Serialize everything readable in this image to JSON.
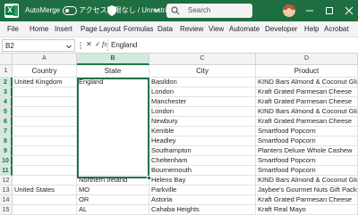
{
  "titlebar": {
    "autosave_label": "AutoMerge",
    "sensitivity_label": "アクセス制限なし / Unrestricted",
    "search_placeholder": "Search"
  },
  "menu": {
    "items": [
      "File",
      "Home",
      "Insert",
      "Page Layout",
      "Formulas",
      "Data",
      "Review",
      "View",
      "Automate",
      "Developer",
      "Help",
      "Acrobat"
    ]
  },
  "formula_bar": {
    "cell_ref": "B2",
    "fx_label": "fx",
    "value": "England"
  },
  "grid": {
    "columns": [
      "A",
      "B",
      "C",
      "D"
    ],
    "rows": [
      "1",
      "2",
      "3",
      "4",
      "5",
      "6",
      "7",
      "8",
      "9",
      "10",
      "11",
      "12",
      "13",
      "14",
      "15"
    ],
    "headers": [
      "Country",
      "State",
      "City",
      "Product"
    ],
    "data": [
      [
        "United Kingdom",
        "England",
        "Basildon",
        "KIND Bars Almond & Coconut Glu"
      ],
      [
        "",
        "",
        "London",
        "Kraft Grated Parmesan Cheese"
      ],
      [
        "",
        "",
        "Manchester",
        "Kraft Grated Parmesan Cheese"
      ],
      [
        "",
        "",
        "London",
        "KIND Bars Almond & Coconut Glu"
      ],
      [
        "",
        "",
        "Newbury",
        "Kraft Grated Parmesan Cheese"
      ],
      [
        "",
        "",
        "Kemble",
        "Smartfood Popcorn"
      ],
      [
        "",
        "",
        "Headley",
        "Smartfood Popcorn"
      ],
      [
        "",
        "",
        "Southampton",
        "Planters Deluxe Whole Cashew"
      ],
      [
        "",
        "",
        "Cheltenham",
        "Smartfood Popcorn"
      ],
      [
        "",
        "",
        "Bournemouth",
        "Smartfood Popcorn"
      ],
      [
        "",
        "Northern Ireland",
        "Helens Bay",
        "KIND Bars Almond & Coconut Glu"
      ],
      [
        "United States",
        "MO",
        "Parkville",
        "Jaybee's Gourmet Nuts Gift Pack"
      ],
      [
        "",
        "OR",
        "Astoria",
        "Kraft Grated Parmesan Cheese"
      ],
      [
        "",
        "AL",
        "Cahaba Heights",
        "Kraft Real Mayo"
      ]
    ]
  },
  "colors": {
    "titlebar": "#1e6e41",
    "selection": "#217346"
  }
}
